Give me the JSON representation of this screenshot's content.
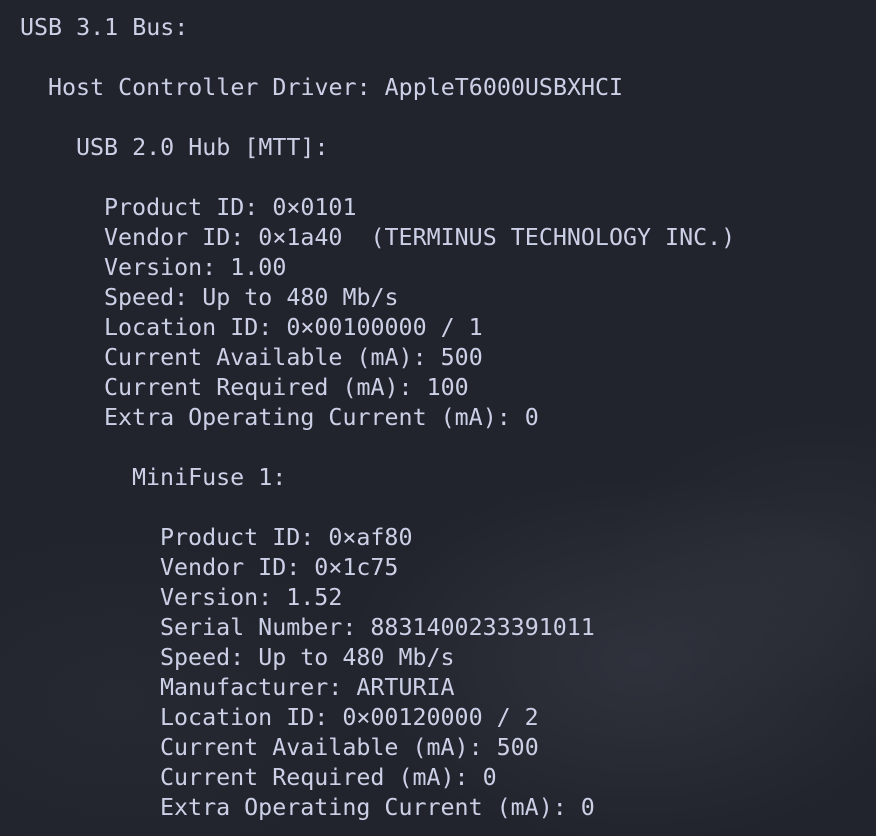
{
  "bus_title": "USB 3.1 Bus:",
  "host_controller": {
    "label": "Host Controller Driver:",
    "value": "AppleT6000USBXHCI"
  },
  "hub": {
    "title": "USB 2.0 Hub [MTT]:",
    "properties": [
      {
        "key": "Product ID:",
        "value": "0×0101"
      },
      {
        "key": "Vendor ID:",
        "value": "0×1a40  (TERMINUS TECHNOLOGY INC.)"
      },
      {
        "key": "Version:",
        "value": "1.00"
      },
      {
        "key": "Speed:",
        "value": "Up to 480 Mb/s"
      },
      {
        "key": "Location ID:",
        "value": "0×00100000 / 1"
      },
      {
        "key": "Current Available (mA):",
        "value": "500"
      },
      {
        "key": "Current Required (mA):",
        "value": "100"
      },
      {
        "key": "Extra Operating Current (mA):",
        "value": "0"
      }
    ]
  },
  "device": {
    "title": "MiniFuse 1:",
    "properties": [
      {
        "key": "Product ID:",
        "value": "0×af80"
      },
      {
        "key": "Vendor ID:",
        "value": "0×1c75"
      },
      {
        "key": "Version:",
        "value": "1.52"
      },
      {
        "key": "Serial Number:",
        "value": "8831400233391011"
      },
      {
        "key": "Speed:",
        "value": "Up to 480 Mb/s"
      },
      {
        "key": "Manufacturer:",
        "value": "ARTURIA"
      },
      {
        "key": "Location ID:",
        "value": "0×00120000 / 2"
      },
      {
        "key": "Current Available (mA):",
        "value": "500"
      },
      {
        "key": "Current Required (mA):",
        "value": "0"
      },
      {
        "key": "Extra Operating Current (mA):",
        "value": "0"
      }
    ]
  },
  "colors": {
    "background": "#22242d",
    "text": "#ccd0e6"
  }
}
